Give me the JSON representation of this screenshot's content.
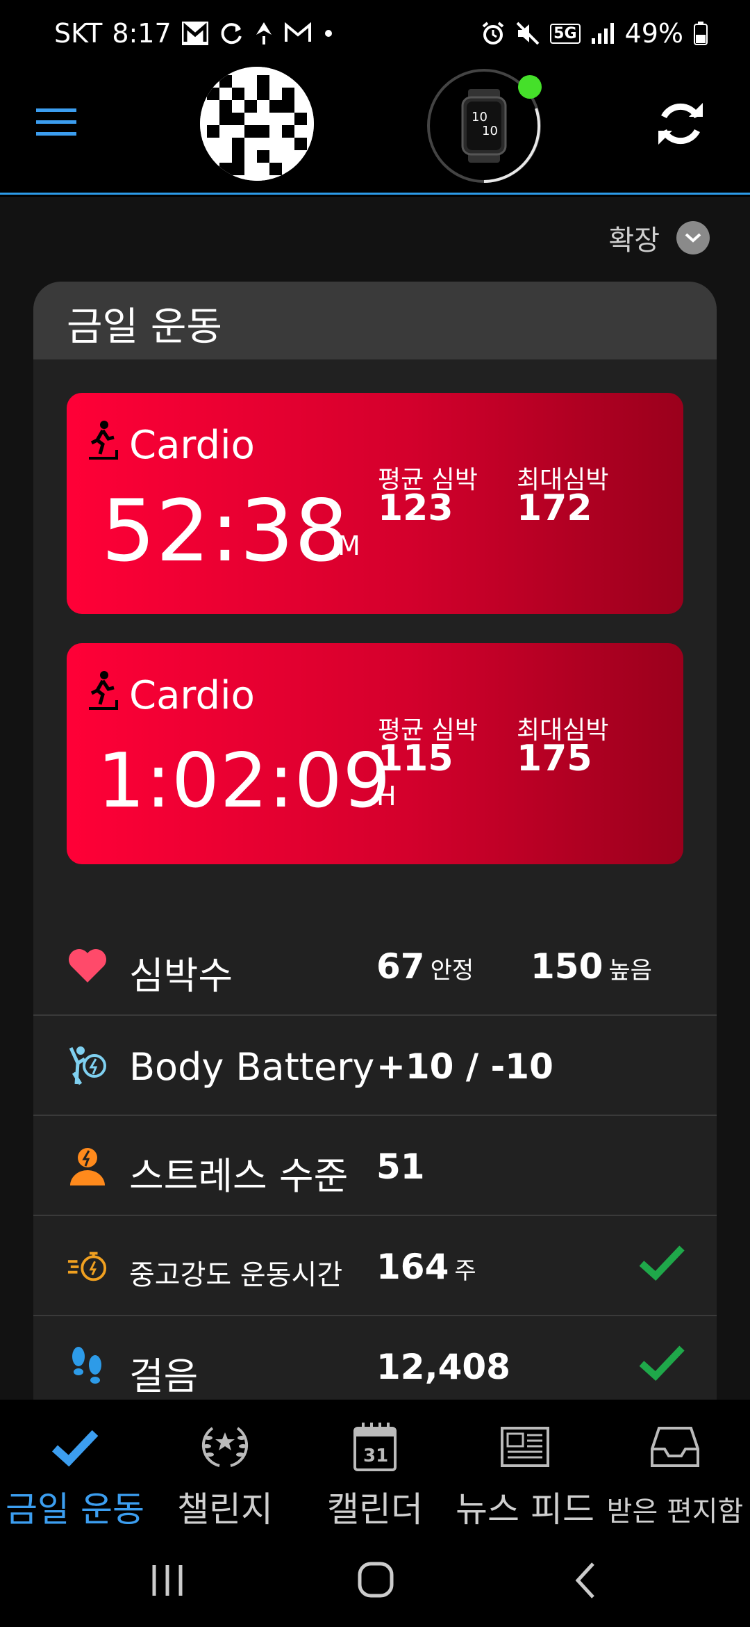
{
  "status_bar": {
    "carrier": "SKT",
    "time": "8:17",
    "network": "5G",
    "battery": "49%"
  },
  "header": {
    "device_status_color": "#45e02a",
    "accent": "#2d9be8"
  },
  "expand": {
    "label": "확장"
  },
  "today": {
    "title": "금일 운동",
    "activities": [
      {
        "type": "Cardio",
        "duration": "52:38",
        "unit": "M",
        "avg_hr_label": "평균 심박",
        "avg_hr": "123",
        "max_hr_label": "최대심박",
        "max_hr": "172"
      },
      {
        "type": "Cardio",
        "duration": "1:02:09",
        "unit": "H",
        "avg_hr_label": "평균 심박",
        "avg_hr": "115",
        "max_hr_label": "최대심박",
        "max_hr": "175"
      }
    ],
    "metrics": {
      "heart_rate": {
        "label": "심박수",
        "resting": "67",
        "resting_label": "안정",
        "high": "150",
        "high_label": "높음"
      },
      "body_battery": {
        "label": "Body Battery",
        "value": "+10 / -10"
      },
      "stress": {
        "label": "스트레스 수준",
        "value": "51"
      },
      "intensity": {
        "label": "중고강도 운동시간",
        "value": "164",
        "unit": "주"
      },
      "steps": {
        "label": "걸음",
        "value": "12,408"
      }
    }
  },
  "bottom_nav": [
    {
      "label": "금일 운동",
      "icon": "check-icon",
      "active": true
    },
    {
      "label": "챌린지",
      "icon": "laurel-icon"
    },
    {
      "label": "캘린더",
      "icon": "calendar-icon",
      "day": "31"
    },
    {
      "label": "뉴스 피드",
      "icon": "newspaper-icon"
    },
    {
      "label": "받은 편지함",
      "icon": "inbox-icon"
    }
  ],
  "colors": {
    "activity_red": "#ff0037",
    "check_green": "#1fa84a",
    "nav_active": "#3c9ef0"
  }
}
